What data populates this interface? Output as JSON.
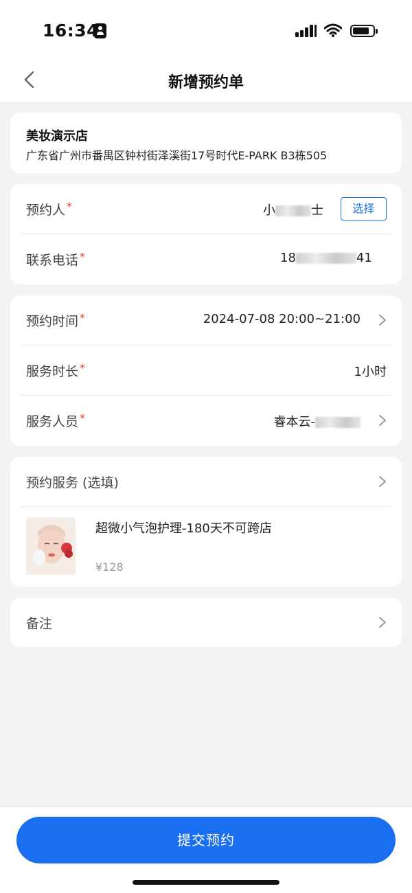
{
  "status_bar": {
    "time": "16:34"
  },
  "nav": {
    "title": "新增预约单",
    "back_icon": "chevron-left-icon"
  },
  "store": {
    "name": "美妆演示店",
    "address": "广东省广州市番禺区钟村街泽溪街17号时代E-PARK B3栋505"
  },
  "customer": {
    "name_label": "预约人",
    "name_prefix": "小",
    "name_suffix": "士",
    "select_label": "选择",
    "phone_label": "联系电话",
    "phone_prefix": "18",
    "phone_suffix": "41"
  },
  "appointment": {
    "time_label": "预约时间",
    "time_value": "2024-07-08 20:00~21:00",
    "duration_label": "服务时长",
    "duration_value": "1小时",
    "staff_label": "服务人员",
    "staff_prefix": "睿本云-"
  },
  "services": {
    "header": "预约服务 (选填)",
    "item": {
      "name": "超微小气泡护理-180天不可跨店",
      "price": "¥128"
    }
  },
  "remark": {
    "label": "备注"
  },
  "required_mark": "*",
  "footer": {
    "submit_label": "提交预约"
  },
  "colors": {
    "primary": "#1a6ef0",
    "required": "#e0392b",
    "background": "#f2f3f5"
  }
}
